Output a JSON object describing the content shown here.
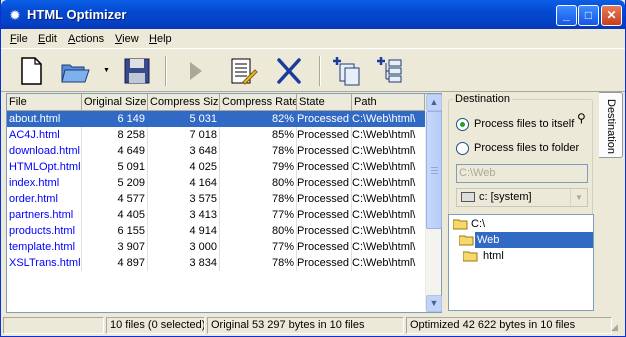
{
  "window": {
    "title": "HTML Optimizer"
  },
  "menu": [
    {
      "label": "File",
      "key": "F"
    },
    {
      "label": "Edit",
      "key": "E"
    },
    {
      "label": "Actions",
      "key": "A"
    },
    {
      "label": "View",
      "key": "V"
    },
    {
      "label": "Help",
      "key": "H"
    }
  ],
  "toolbar": [
    "new-file-icon",
    "open-folder-icon",
    "save-disk-icon",
    "run-play-icon",
    "properties-list-icon",
    "delete-x-icon",
    "add-files-icon",
    "add-folder-list-icon"
  ],
  "table": {
    "columns": [
      "File",
      "Original Size",
      "Compress Size",
      "Compress Rate",
      "State",
      "Path"
    ],
    "rows": [
      [
        "about.html",
        "6 149",
        "5 031",
        "82%",
        "Processed",
        "C:\\Web\\html\\"
      ],
      [
        "AC4J.html",
        "8 258",
        "7 018",
        "85%",
        "Processed",
        "C:\\Web\\html\\"
      ],
      [
        "download.html",
        "4 649",
        "3 648",
        "78%",
        "Processed",
        "C:\\Web\\html\\"
      ],
      [
        "HTMLOpt.html",
        "5 091",
        "4 025",
        "79%",
        "Processed",
        "C:\\Web\\html\\"
      ],
      [
        "index.html",
        "5 209",
        "4 164",
        "80%",
        "Processed",
        "C:\\Web\\html\\"
      ],
      [
        "order.html",
        "4 577",
        "3 575",
        "78%",
        "Processed",
        "C:\\Web\\html\\"
      ],
      [
        "partners.html",
        "4 405",
        "3 413",
        "77%",
        "Processed",
        "C:\\Web\\html\\"
      ],
      [
        "products.html",
        "6 155",
        "4 914",
        "80%",
        "Processed",
        "C:\\Web\\html\\"
      ],
      [
        "template.html",
        "3 907",
        "3 000",
        "77%",
        "Processed",
        "C:\\Web\\html\\"
      ],
      [
        "XSLTrans.html",
        "4 897",
        "3 834",
        "78%",
        "Processed",
        "C:\\Web\\html\\"
      ]
    ],
    "selected_row": 0
  },
  "destination": {
    "title": "Destination",
    "option_itself": "Process files to itself",
    "option_folder": "Process files to folder",
    "selected_option": "itself",
    "folder_path": "C:\\Web",
    "drive": "c: [system]",
    "tree": [
      "C:\\",
      "Web",
      "html"
    ],
    "selected_tree": "Web"
  },
  "side_tab": "Destination",
  "status": {
    "files": "10 files (0 selected)",
    "original": "Original 53 297 bytes in 10 files",
    "optimized": "Optimized 42 622 bytes in 10 files"
  },
  "colors": {
    "selection": "#316ac5",
    "link": "#0000ff",
    "titlebar": "#0549d1"
  }
}
